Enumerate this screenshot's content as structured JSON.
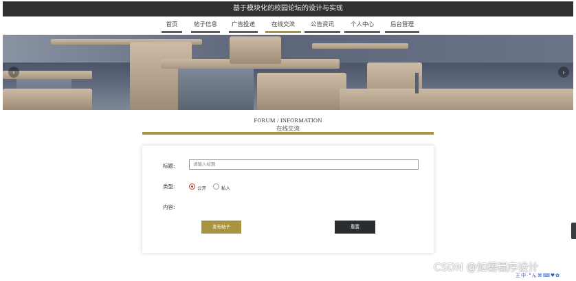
{
  "site": {
    "title": "基于模块化的校园论坛的设计与实现"
  },
  "nav": {
    "items": [
      {
        "label": "首页"
      },
      {
        "label": "帖子信息"
      },
      {
        "label": "广告投递"
      },
      {
        "label": "在线交流"
      },
      {
        "label": "公告资讯"
      },
      {
        "label": "个人中心"
      },
      {
        "label": "后台管理"
      }
    ],
    "active_index": 3
  },
  "banner": {
    "prev_icon": "chevron-left-icon",
    "next_icon": "chevron-right-icon",
    "prev_glyph": "‹",
    "next_glyph": "›"
  },
  "section": {
    "title_en": "FORUM / INFORMATION",
    "title_cn": "在线交流"
  },
  "form": {
    "title_label": "标题:",
    "title_placeholder": "请输入标题",
    "title_value": "",
    "type_label": "类型:",
    "type_options": [
      {
        "label": "公开",
        "checked": true
      },
      {
        "label": "私人",
        "checked": false
      }
    ],
    "content_label": "内容:",
    "publish_label": "发布帖子",
    "reset_label": "重置"
  },
  "watermark": {
    "text": "CSDN @如梧程序设计"
  },
  "ime_toolbar": {
    "text": "王中·°ん⌘⌨♥✿"
  },
  "colors": {
    "accent": "#a8943f",
    "dark": "#2f3132",
    "radio_checked": "#c0392b"
  }
}
